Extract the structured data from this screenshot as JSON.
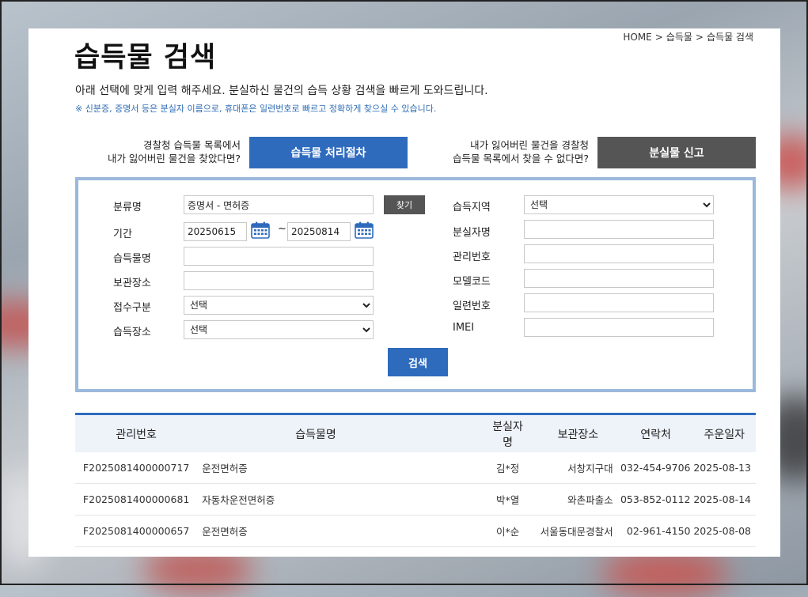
{
  "breadcrumb": {
    "home": "HOME",
    "sep": ">",
    "level1": "습득물",
    "level2": "습득물 검색"
  },
  "header": {
    "title": "습득물 검색",
    "description": "아래 선택에 맞게 입력 해주세요. 분실하신 물건의 습득 상황 검색을 빠르게 도와드립니다.",
    "note": "※ 신분증, 증명서 등은 분실자 이름으로, 휴대폰은 일련번호로 빠르고 정확하게 찾으실 수 있습니다."
  },
  "guides": {
    "left_line1": "경찰청 습득물 목록에서",
    "left_line2": "내가 잃어버린 물건을 찾았다면?",
    "left_button": "습득물 처리절차",
    "right_line1": "내가 잃어버린 물건을 경찰청",
    "right_line2": "습득물 목록에서 찾을 수 없다면?",
    "right_button": "분실물 신고"
  },
  "form": {
    "category_label": "분류명",
    "category_value": "증명서 - 면허증",
    "find_button": "찾기",
    "period_label": "기간",
    "date_from": "20250615",
    "date_tilde": "~",
    "date_to": "20250814",
    "item_name_label": "습득물명",
    "storage_label": "보관장소",
    "reception_label": "접수구분",
    "reception_value": "선택",
    "found_place_label": "습득장소",
    "found_place_value": "선택",
    "region_label": "습득지역",
    "region_value": "선택",
    "loser_label": "분실자명",
    "mgmt_no_label": "관리번호",
    "model_label": "모델코드",
    "serial_label": "일련번호",
    "imei_label": "IMEI",
    "search_button": "검색"
  },
  "table": {
    "headers": [
      "관리번호",
      "습득물명",
      "분실자명",
      "보관장소",
      "연락처",
      "주운일자"
    ],
    "rows": [
      {
        "id": "F2025081400000717",
        "name": "운전면허증",
        "loser": "김*정",
        "place": "서창지구대",
        "tel": "032-454-9706",
        "date": "2025-08-13"
      },
      {
        "id": "F2025081400000681",
        "name": "자동차운전면허증",
        "loser": "박*열",
        "place": "와촌파출소",
        "tel": "053-852-0112",
        "date": "2025-08-14"
      },
      {
        "id": "F2025081400000657",
        "name": "운전면허증",
        "loser": "이*순",
        "place": "서울동대문경찰서",
        "tel": "02-961-4150",
        "date": "2025-08-08"
      }
    ]
  },
  "colors": {
    "primary": "#2e6bbd",
    "dark_button": "#555555",
    "box_border": "#9bb8dd",
    "note_text": "#2f6db5"
  },
  "icons": {
    "calendar": "calendar-icon",
    "chevron": "chevron-down-icon"
  }
}
